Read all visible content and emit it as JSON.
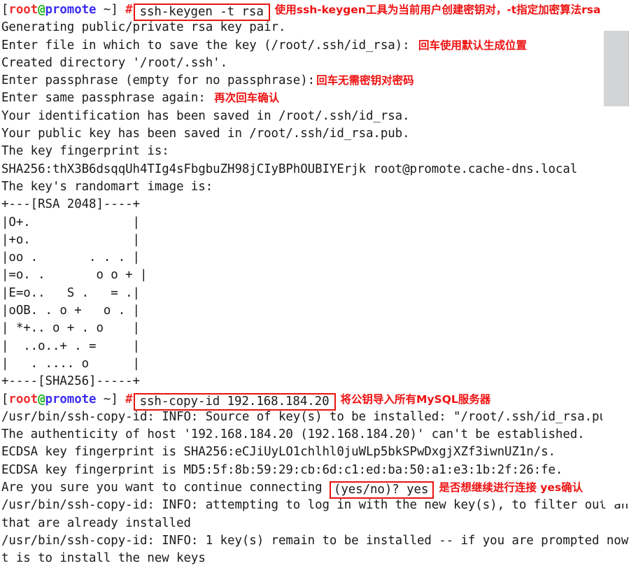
{
  "terminal": {
    "prompt": {
      "open_bracket": "[",
      "user": "root",
      "at": "@",
      "host": "promote",
      "close": " ~]",
      "hash": "#"
    },
    "commands": {
      "keygen": "ssh-keygen -t rsa",
      "copy_id": "ssh-copy-id 192.168.184.20"
    },
    "annotations": {
      "keygen": "使用ssh-keygen工具为当前用户创建密钥对，-t指定加密算法rsa",
      "default_path": "回车使用默认生成位置",
      "no_passphrase": "回车无需密钥对密码",
      "confirm_again": "再次回车确认",
      "copy_id": "将公钥导入所有MySQL服务器",
      "continue_yes": "是否想继续进行连接 yes确认"
    },
    "lines": {
      "generating": "Generating public/private rsa key pair.",
      "enter_file": "Enter file in which to save the key (/root/.ssh/id_rsa): ",
      "created_dir": "Created directory '/root/.ssh'.",
      "enter_passphrase": "Enter passphrase (empty for no passphrase):",
      "enter_same": "Enter same passphrase again: ",
      "identification_saved": "Your identification has been saved in /root/.ssh/id_rsa.",
      "public_key_saved": "Your public key has been saved in /root/.ssh/id_rsa.pub.",
      "fingerprint_is": "The key fingerprint is:",
      "fingerprint_value": "SHA256:thX3B6dsqqUh4TIg4sFbgbuZH98jCIyBPhOUBIYErjk root@promote.cache-dns.local",
      "randomart_is": "The key's randomart image is:",
      "copy_id_source": "/usr/bin/ssh-copy-id: INFO: Source of key(s) to be installed: \"/root/.ssh/id_rsa.pub\"",
      "authenticity": "The authenticity of host '192.168.184.20 (192.168.184.20)' can't be established.",
      "ecdsa_sha256": "ECDSA key fingerprint is SHA256:eCJiUyLO1chlhl0juWLp5bkSPwDxgjXZf3iwnUZ1n/s.",
      "ecdsa_md5": "ECDSA key fingerprint is MD5:5f:8b:59:29:cb:6d:c1:ed:ba:50:a1:e3:1b:2f:26:fe.",
      "are_you_sure_prefix": "Are you sure you want to continue connecting ",
      "yes_no_prompt": "(yes/no)? yes",
      "attempting_login": "/usr/bin/ssh-copy-id: INFO: attempting to log in with the new key(s), to filter out any",
      "already_installed": "that are already installed",
      "keys_remain": "/usr/bin/ssh-copy-id: INFO: 1 key(s) remain to be installed -- if you are prompted now i",
      "install_new_keys": "t is to install the new keys"
    },
    "randomart": [
      "+---[RSA 2048]----+",
      "|O+.              |",
      "|+o.              |",
      "|oo .       . . . |",
      "|=o. .       o o + |",
      "|E=o..   S .   = .|",
      "|oOB. . o +   o . |",
      "| *+.. o + . o    |",
      "|  ..o..+ . =     |",
      "|   . .... o      |",
      "+----[SHA256]-----+"
    ],
    "scrollbar": {
      "thumb_color": "#d2d4d6",
      "track_color": "#ffffff"
    },
    "colors": {
      "user": "#ef2d2d",
      "at": "#13b213",
      "host": "#3b2df0",
      "annotation": "#ee1111",
      "box_border": "#e8140f",
      "text": "#1a1a1a"
    }
  }
}
